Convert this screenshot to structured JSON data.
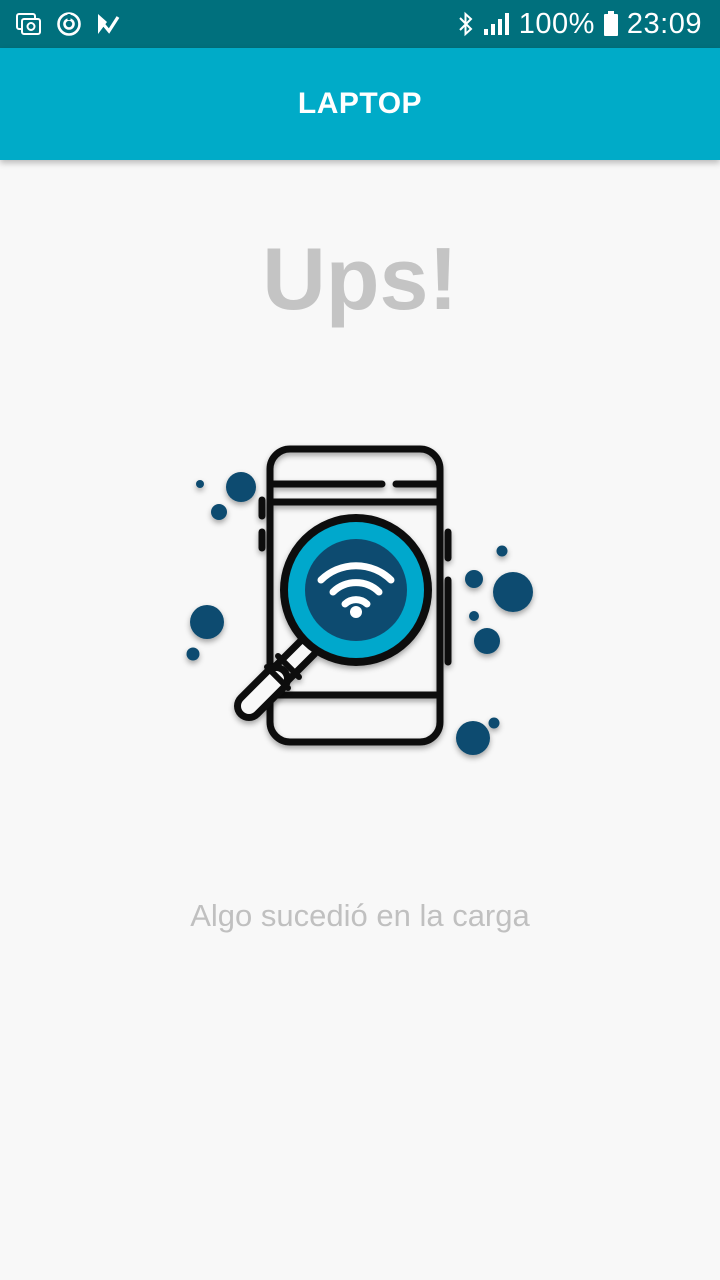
{
  "status_bar": {
    "battery": "100%",
    "time": "23:09",
    "icons": [
      "screenshot-icon",
      "sync-icon",
      "check-icon",
      "bluetooth-icon",
      "signal-icon",
      "battery-icon"
    ]
  },
  "app_bar": {
    "title": "LAPTOP"
  },
  "main": {
    "heading": "Ups!",
    "illustration_icon": "phone-wifi-search-icon",
    "message": "Algo sucedió en la carga"
  },
  "colors": {
    "status_bar": "#00707d",
    "app_bar": "#00abc8",
    "accent_dark": "#0f4c6f",
    "accent_light": "#00a8cc"
  }
}
